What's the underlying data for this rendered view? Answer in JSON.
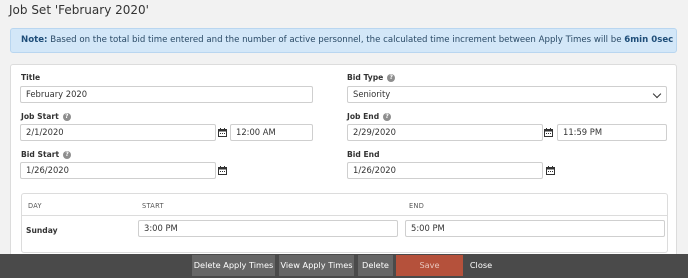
{
  "header": {
    "title": "Job Set 'February 2020'"
  },
  "note": {
    "label": "Note:",
    "text": "Based on the total bid time entered and the number of active personnel, the calculated time increment between Apply Times will be",
    "value": "6min 0sec"
  },
  "form": {
    "title_label": "Title",
    "title_value": "February 2020",
    "bid_type_label": "Bid Type",
    "bid_type_value": "Seniority",
    "job_start_label": "Job Start",
    "job_start_date": "2/1/2020",
    "job_start_time": "12:00 AM",
    "job_end_label": "Job End",
    "job_end_date": "2/29/2020",
    "job_end_time": "11:59 PM",
    "bid_start_label": "Bid Start",
    "bid_start_date": "1/26/2020",
    "bid_end_label": "Bid End",
    "bid_end_date": "1/26/2020"
  },
  "schedule": {
    "columns": [
      "DAY",
      "START",
      "END"
    ],
    "rows": [
      {
        "day": "Sunday",
        "start": "3:00 PM",
        "end": "5:00 PM"
      }
    ]
  },
  "footer": {
    "delete_apply_times": "Delete Apply Times",
    "view_apply_times": "View Apply Times",
    "delete": "Delete",
    "save": "Save",
    "close": "Close"
  },
  "icons": {
    "help": "help-circle-icon",
    "calendar": "calendar-icon",
    "dropdown": "chevron-down-icon"
  },
  "colors": {
    "note_bg": "#d3e7f8",
    "footer_bg": "#4a4a4a",
    "save_bg": "#b5513b",
    "button_bg": "#666666"
  }
}
